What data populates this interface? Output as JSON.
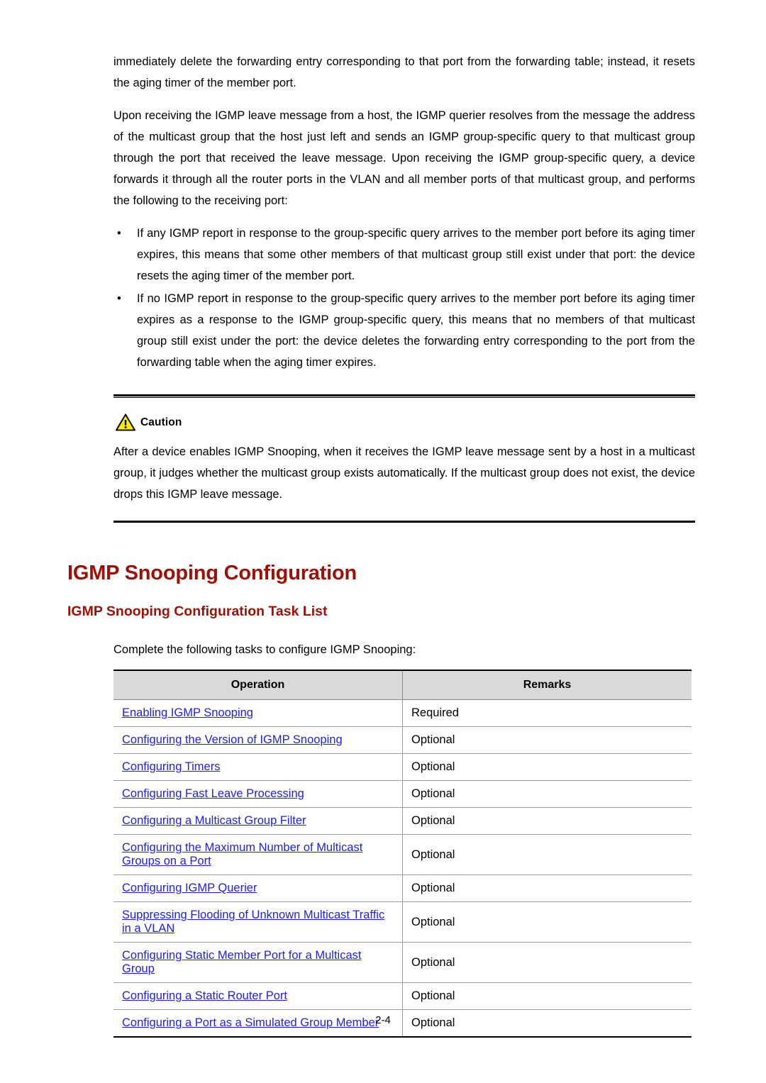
{
  "document": {
    "page_number": "2-4"
  },
  "body": {
    "paragraphs": [
      "immediately delete the forwarding entry corresponding to that port from the forwarding table; instead, it resets the aging timer of the member port.",
      "Upon receiving the IGMP leave message from a host, the IGMP querier resolves from the message the address of the multicast group that the host just left and sends an IGMP group-specific query to that multicast group through the port that received the leave message. Upon receiving the IGMP group-specific query, a device forwards it through all the router ports in the VLAN and all member ports of that multicast group, and performs the following to the receiving port:"
    ],
    "bullets": [
      "If any IGMP report in response to the group-specific query arrives to the member port before its aging timer expires, this means that some other members of that multicast group still exist under that port: the device resets the aging timer of the member port.",
      "If no IGMP report in response to the group-specific query arrives to the member port before its aging timer expires as a response to the IGMP group-specific query, this means that no members of that multicast group still exist under the port: the device deletes the forwarding entry corresponding to the port from the forwarding table when the aging timer expires."
    ],
    "bullet_glyph": "•"
  },
  "caution": {
    "icon": "warning-triangle-icon",
    "label": "Caution",
    "icon_fill": "#ffed00",
    "icon_stroke": "#000000",
    "text": "After a device enables IGMP Snooping, when it receives the IGMP leave message sent by a host in a multicast group, it judges whether the multicast group exists automatically. If the multicast group does not exist, the device drops this IGMP leave message."
  },
  "headings": {
    "main": "IGMP Snooping Configuration",
    "sub": "IGMP Snooping Configuration Task List",
    "color": "#9c1006"
  },
  "intro": "Complete the following tasks to configure IGMP Snooping:",
  "table": {
    "headers": {
      "operation": "Operation",
      "remarks": "Remarks"
    },
    "header_bg": "#d9d9d9",
    "link_color": "#2222dd",
    "rows": [
      {
        "operation": "Enabling IGMP Snooping",
        "remarks": "Required"
      },
      {
        "operation": "Configuring the Version of IGMP Snooping",
        "remarks": "Optional"
      },
      {
        "operation": "Configuring Timers",
        "remarks": "Optional"
      },
      {
        "operation": "Configuring Fast Leave Processing",
        "remarks": "Optional"
      },
      {
        "operation": "Configuring a Multicast Group Filter",
        "remarks": "Optional"
      },
      {
        "operation": "Configuring the Maximum Number of Multicast Groups on a Port",
        "remarks": "Optional"
      },
      {
        "operation": "Configuring IGMP Querier",
        "remarks": "Optional"
      },
      {
        "operation": "Suppressing Flooding of Unknown Multicast Traffic in a VLAN",
        "remarks": "Optional"
      },
      {
        "operation": "Configuring Static Member Port for a Multicast Group",
        "remarks": "Optional"
      },
      {
        "operation": "Configuring a Static Router Port",
        "remarks": "Optional"
      },
      {
        "operation": "Configuring a Port as a Simulated Group Member",
        "remarks": "Optional"
      }
    ]
  }
}
